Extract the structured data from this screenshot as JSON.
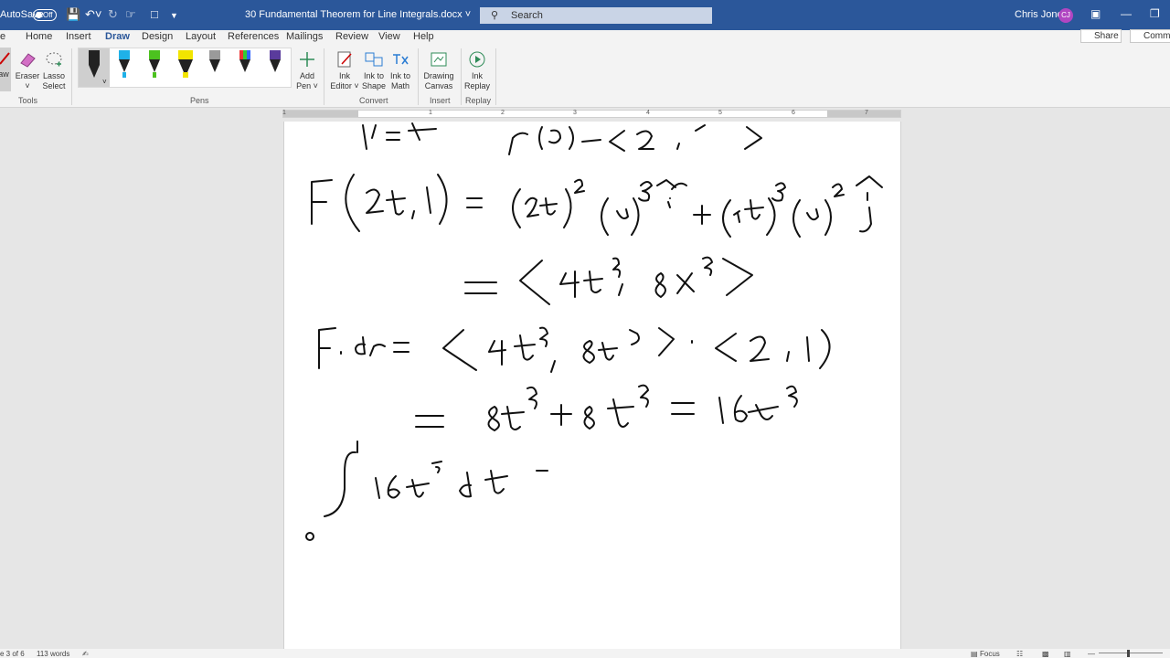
{
  "titlebar": {
    "autosave_label": "AutoSave",
    "autosave_state": "Off",
    "document_title": "30 Fundamental Theorem for Line Integrals.docx",
    "search_placeholder": "Search",
    "user_name": "Chris Jones",
    "user_initials": "CJ"
  },
  "menu": {
    "tabs": [
      "Home",
      "Insert",
      "Draw",
      "Design",
      "Layout",
      "References",
      "Mailings",
      "Review",
      "View",
      "Help"
    ],
    "active_tab": "Draw",
    "share_label": "Share",
    "comments_label": "Comme"
  },
  "ribbon": {
    "draw_label": "aw",
    "eraser_label": "Eraser",
    "lasso_label_1": "Lasso",
    "lasso_label_2": "Select",
    "tools_group": "Tools",
    "pens_group": "Pens",
    "add_pen_1": "Add",
    "add_pen_2": "Pen",
    "ink_editor_1": "Ink",
    "ink_editor_2": "Editor",
    "ink_shape_1": "Ink to",
    "ink_shape_2": "Shape",
    "ink_math_1": "Ink to",
    "ink_math_2": "Math",
    "convert_group": "Convert",
    "drawing_canvas_1": "Drawing",
    "drawing_canvas_2": "Canvas",
    "insert_group": "Insert",
    "ink_replay_1": "Ink",
    "ink_replay_2": "Replay",
    "replay_group": "Replay"
  },
  "ruler": {
    "numbers": [
      "1",
      "1",
      "2",
      "3",
      "4",
      "5",
      "6",
      "7"
    ]
  },
  "status": {
    "page": "e 3 of 6",
    "words": "113 words",
    "focus": "Focus"
  },
  "colors": {
    "word_blue": "#2b579a",
    "avatar": "#b146c2"
  }
}
